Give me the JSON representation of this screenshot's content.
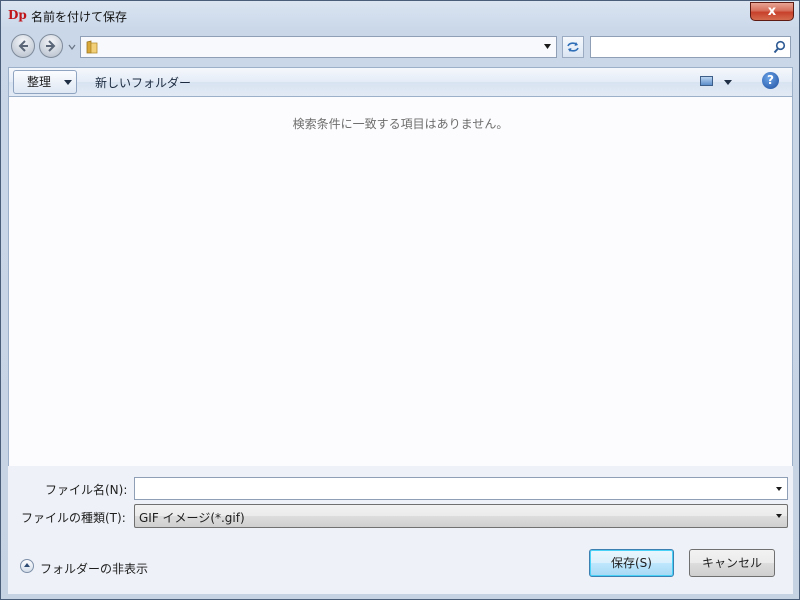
{
  "window": {
    "title": "名前を付けて保存",
    "app_icon_glyph": "Dp",
    "close_glyph": "x",
    "colors": {
      "frame": "#c6d3e3",
      "close_button": "#c7402a",
      "primary_button": "#bee6fd",
      "empty_text": "#6d6d6d"
    }
  },
  "navigation": {
    "back_icon": "back-arrow-icon",
    "forward_icon": "forward-arrow-icon",
    "address_path": "",
    "refresh_icon": "refresh-icon",
    "search_placeholder": "",
    "search_icon": "search-icon"
  },
  "toolbar": {
    "organize_label": "整理",
    "new_folder_label": "新しいフォルダー",
    "view_icon": "view-options-icon",
    "help_glyph": "?"
  },
  "file_list": {
    "empty_message": "検索条件に一致する項目はありません。",
    "items": []
  },
  "form": {
    "filename_label": "ファイル名(N):",
    "filename_value": "",
    "filetype_label": "ファイルの種類(T):",
    "filetype_value": "GIF イメージ(*.gif)"
  },
  "footer": {
    "hide_folders_label": "フォルダーの非表示",
    "save_label": "保存(S)",
    "cancel_label": "キャンセル"
  }
}
